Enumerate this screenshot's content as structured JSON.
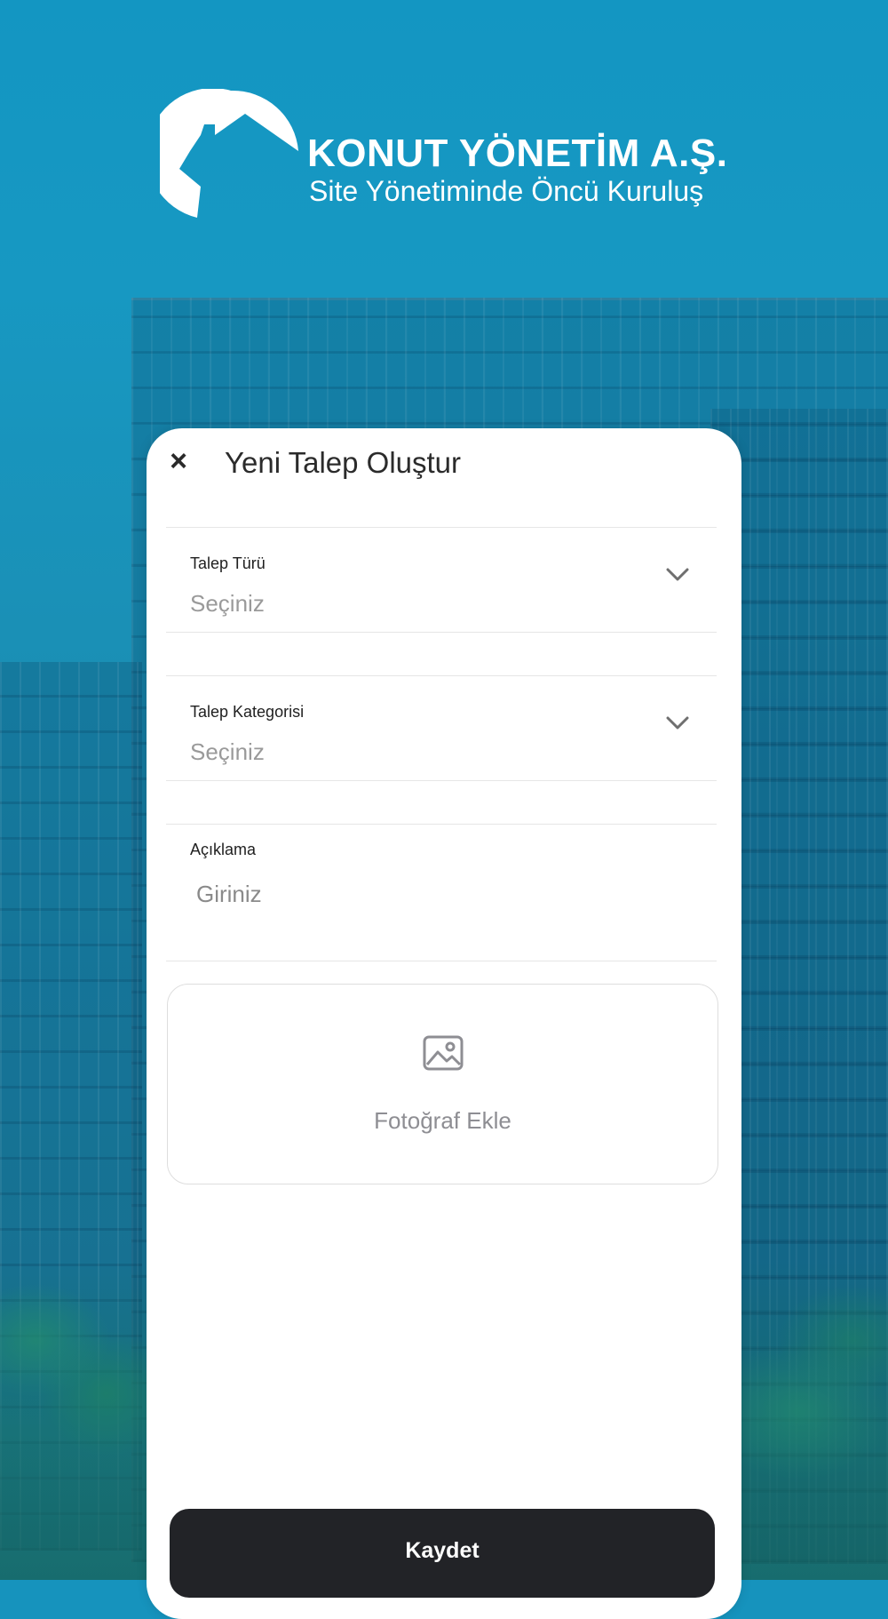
{
  "branding": {
    "title": "KONUT YÖNETİM A.Ş.",
    "subtitle": "Site Yönetiminde Öncü Kuruluş"
  },
  "modal": {
    "title": "Yeni Talep Oluştur",
    "close_icon": "close-icon"
  },
  "form": {
    "request_type": {
      "label": "Talep Türü",
      "value": "Seçiniz"
    },
    "request_category": {
      "label": "Talep Kategorisi",
      "value": "Seçiniz"
    },
    "description": {
      "label": "Açıklama",
      "placeholder": "Giriniz"
    },
    "photo": {
      "label": "Fotoğraf Ekle",
      "icon": "image-icon"
    }
  },
  "actions": {
    "save_label": "Kaydet"
  },
  "colors": {
    "background": "#1693bd",
    "card": "#ffffff",
    "button": "#222327",
    "placeholder": "#9a9a9a"
  }
}
